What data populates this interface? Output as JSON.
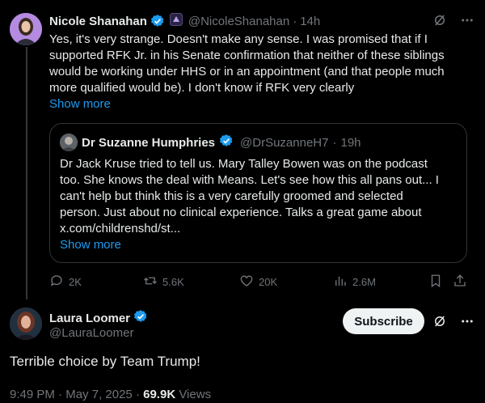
{
  "top_tweet": {
    "author_name": "Nicole Shanahan",
    "handle": "@NicoleShanahan",
    "sep": "·",
    "time": "14h",
    "text": "Yes, it's very strange. Doesn't make any sense. I was promised that if I\nsupported RFK Jr. in his Senate confirmation that neither of these siblings\nwould be working under HHS or in an appointment (and that people much\nmore qualified would be). I don't know if RFK very clearly",
    "show_more": "Show more"
  },
  "quote": {
    "author_name": "Dr Suzanne Humphries",
    "handle": "@DrSuzanneH7",
    "sep": "·",
    "time": "19h",
    "text": "Dr Jack Kruse tried to tell us. Mary Talley Bowen was on the podcast\ntoo. She knows the deal with Means. Let's see how this all pans out... I\ncan't help but think this is a very carefully groomed and selected\nperson. Just about no clinical experience. Talks a great game about\nx.com/childrenshd/st...",
    "show_more": "Show more"
  },
  "actions": {
    "replies": "2K",
    "reposts": "5.6K",
    "likes": "20K",
    "views": "2.6M"
  },
  "main_tweet": {
    "author_name": "Laura Loomer",
    "handle": "@LauraLoomer",
    "subscribe_label": "Subscribe",
    "text": "Terrible choice by Team Trump!",
    "time": "9:49 PM",
    "sep": "·",
    "date": "May 7, 2025",
    "sep2": "·",
    "views_count": "69.9K",
    "views_label": "Views"
  },
  "colors": {
    "background": "#000000",
    "text": "#e7e9ea",
    "muted": "#71767b",
    "accent": "#1d9bf0",
    "border": "#2f3336"
  },
  "icons": [
    "verified-badge-icon",
    "affiliate-badge-icon",
    "grok-icon",
    "more-icon",
    "reply-icon",
    "repost-icon",
    "like-icon",
    "views-icon",
    "bookmark-icon",
    "share-icon"
  ]
}
